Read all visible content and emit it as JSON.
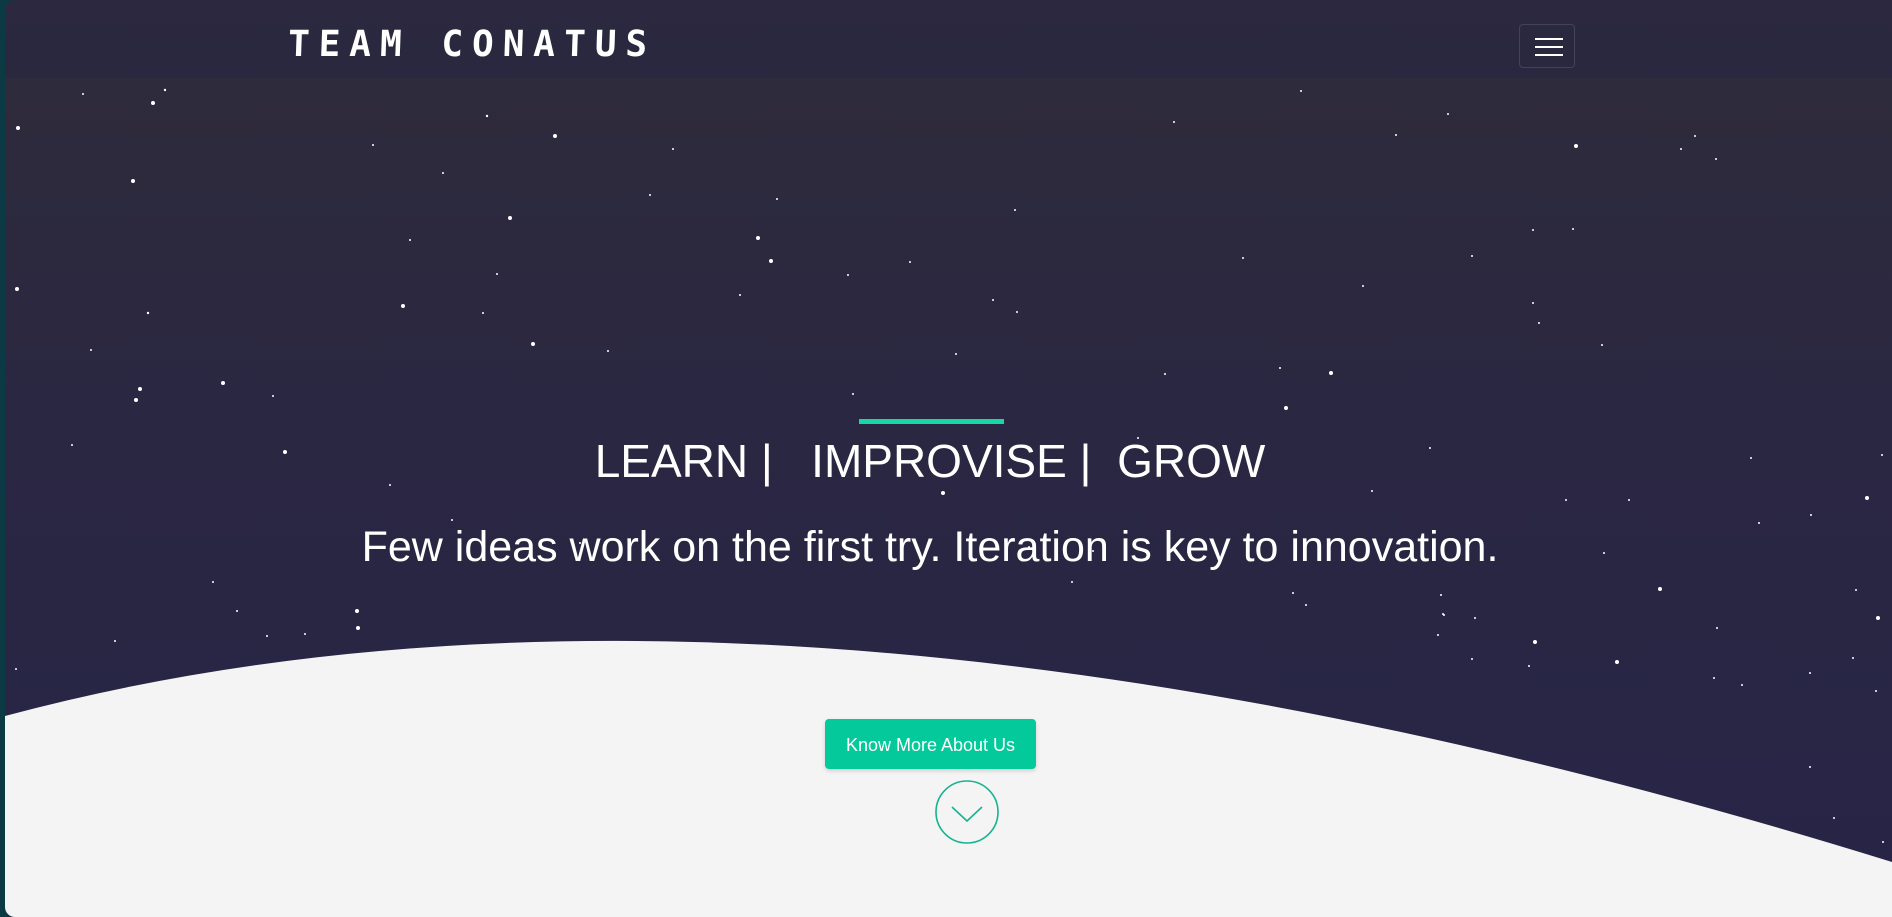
{
  "brand": {
    "name": "TEAM CONATUS"
  },
  "navbar": {
    "menu_icon": "hamburger-menu-icon"
  },
  "hero": {
    "tagline": "LEARN |   IMPROVISE |  GROW",
    "subtitle": "Few ideas work on the first try. Iteration is key to innovation.",
    "cta_label": "Know More About Us",
    "scroll_icon": "chevron-down-circle-icon"
  },
  "colors": {
    "accent": "#1ad6a5",
    "button": "#04c99a",
    "background_dark": "#2a2742",
    "planet": "#f4f4f4"
  }
}
